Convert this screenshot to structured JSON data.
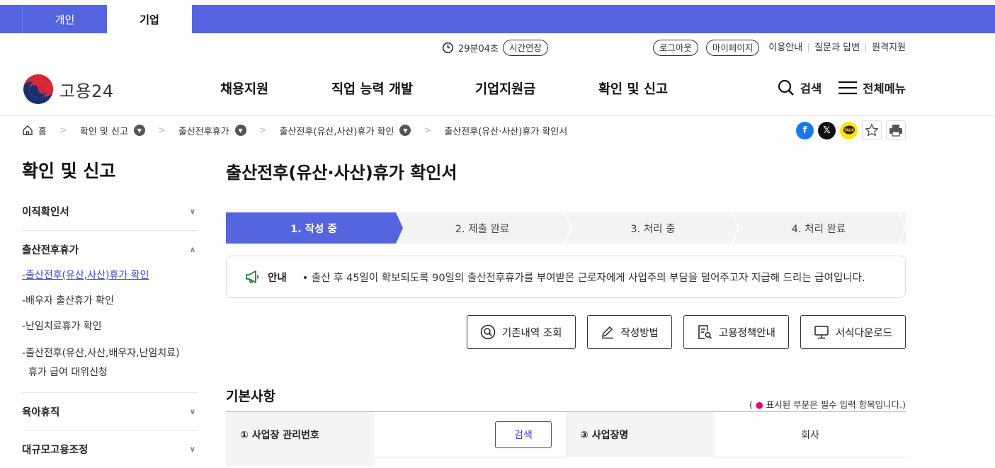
{
  "topbar": {
    "personal": "개인",
    "business": "기업"
  },
  "util": {
    "timer": "29분04초",
    "extend": "시간연장",
    "logout": "로그아웃",
    "mypage": "마이페이지",
    "links": [
      "이용안내",
      "질문과 답변",
      "원격지원"
    ]
  },
  "header": {
    "logo_text": "고용24",
    "nav": [
      "채용지원",
      "직업 능력 개발",
      "기업지원금",
      "확인 및 신고"
    ],
    "search": "검색",
    "menu": "전체메뉴"
  },
  "breadcrumb": {
    "home": "홈",
    "items": [
      "확인 및 신고",
      "출산전후휴가",
      "출산전후(유산,사산)휴가 확인"
    ],
    "current": "출산전후(유산·사산)휴가 확인서"
  },
  "social": {
    "icons": [
      "facebook-icon",
      "x-icon",
      "kakaotalk-icon",
      "star-icon",
      "print-icon"
    ],
    "facebook_color": "#1877f2",
    "kakao_color": "#fee500"
  },
  "sidebar": {
    "title": "확인 및 신고",
    "sections": [
      {
        "label": "이직확인서",
        "expanded": false
      },
      {
        "label": "출산전후휴가",
        "expanded": true,
        "items": [
          "출산전후(유산,사산)휴가 확인",
          "배우자 출산휴가 확인",
          "난임치료휴가 확인"
        ],
        "item4_line1": "출산전후(유산,사산,배우자,난임치료)",
        "item4_line2": "휴가 급여 대위신청"
      },
      {
        "label": "육아휴직",
        "expanded": false
      },
      {
        "label": "대규모고용조정",
        "expanded": false
      }
    ]
  },
  "main": {
    "title": "출산전후(유산·사산)휴가 확인서",
    "steps": [
      "1. 작성 중",
      "2. 제출 완료",
      "3. 처리 중",
      "4. 처리 완료"
    ],
    "active_step": 1,
    "accent": "#5565e0",
    "notice_label": "안내",
    "notice_text": "• 출산 후 45일이 확보되도록 90일의 출산전후휴가를 부여받은 근로자에게 사업주의 부담을 덜어주고자 지급해 드리는 급여입니다.",
    "buttons": [
      "기존내역 조회",
      "작성방법",
      "고용정책안내",
      "서식다운로드"
    ],
    "section_title": "기본사항",
    "req_note_pre": "(",
    "req_note_dot": "●",
    "req_note_text": "표시된 부분은 필수 입력 항목입니다.)",
    "form": {
      "field1": "① 사업장 관리번호",
      "search_button": "검색",
      "field3": "③ 사업장명",
      "field3_value": "회사"
    }
  }
}
